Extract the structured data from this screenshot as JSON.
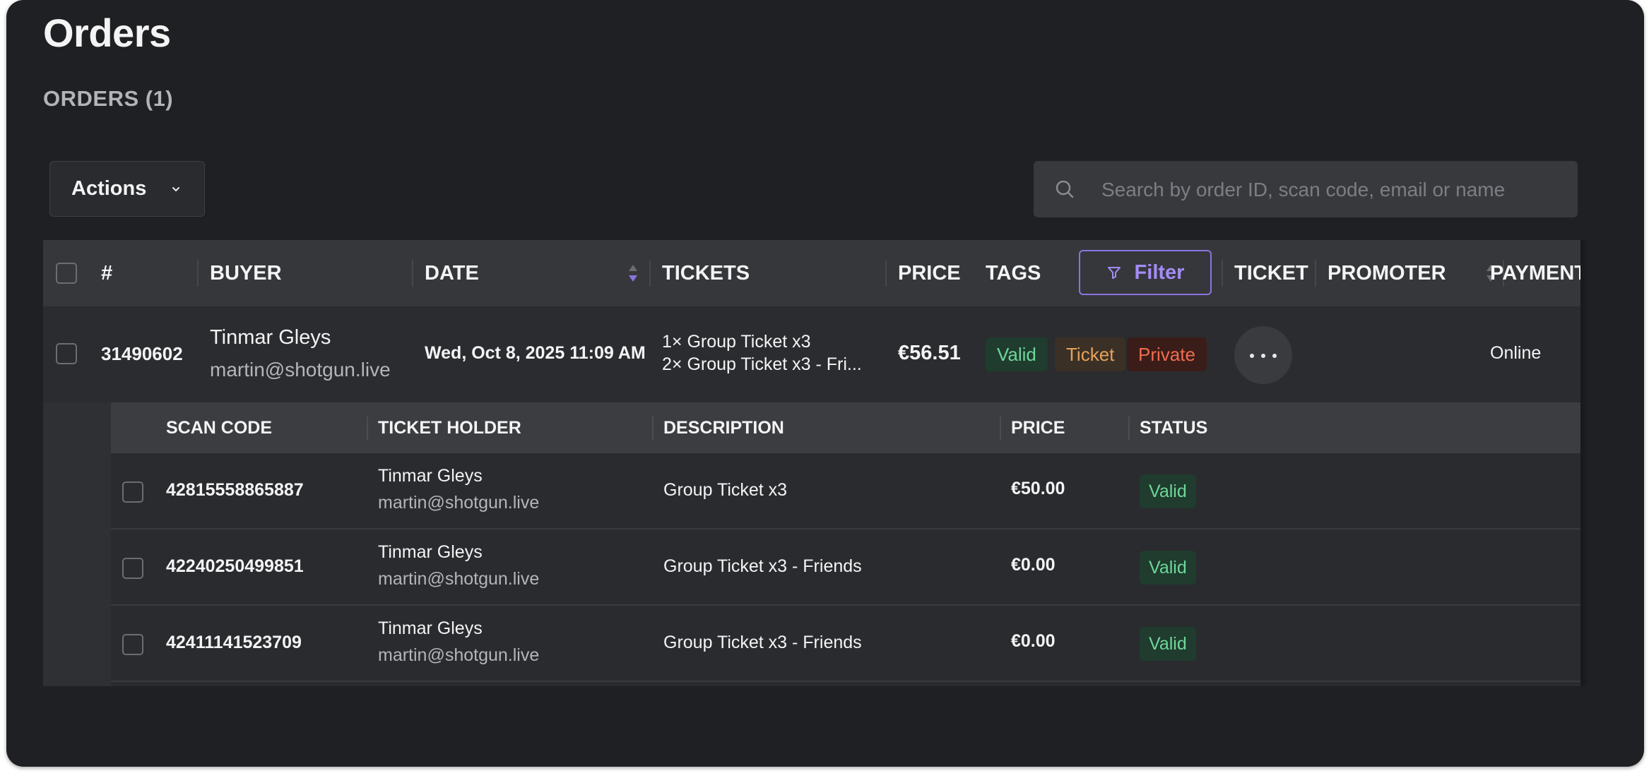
{
  "page": {
    "title": "Orders",
    "section_title": "ORDERS (1)"
  },
  "toolbar": {
    "actions_label": "Actions",
    "search_placeholder": "Search by order ID, scan code, email or name"
  },
  "table": {
    "headers": {
      "number": "#",
      "buyer": "BUYER",
      "date": "DATE",
      "tickets": "TICKETS",
      "price": "PRICE",
      "tags": "TAGS",
      "filter": "Filter",
      "ticket": "TICKET",
      "promoter": "PROMOTER",
      "payment": "PAYMENT"
    },
    "order": {
      "id": "31490602",
      "buyer_name": "Tinmar Gleys",
      "buyer_email": "martin@shotgun.live",
      "date": "Wed, Oct 8, 2025 11:09 AM",
      "tickets_line1": "1× Group Ticket x3",
      "tickets_line2": "2× Group Ticket x3 - Fri...",
      "price": "€56.51",
      "tags": [
        "Valid",
        "Ticket",
        "Private"
      ],
      "payment": "Online"
    },
    "sub_headers": {
      "scan_code": "SCAN CODE",
      "ticket_holder": "TICKET HOLDER",
      "description": "DESCRIPTION",
      "price": "PRICE",
      "status": "STATUS"
    },
    "tickets": [
      {
        "scan_code": "42815558865887",
        "holder_name": "Tinmar Gleys",
        "holder_email": "martin@shotgun.live",
        "description": "Group Ticket x3",
        "price": "€50.00",
        "status": "Valid"
      },
      {
        "scan_code": "42240250499851",
        "holder_name": "Tinmar Gleys",
        "holder_email": "martin@shotgun.live",
        "description": "Group Ticket x3 - Friends",
        "price": "€0.00",
        "status": "Valid"
      },
      {
        "scan_code": "42411141523709",
        "holder_name": "Tinmar Gleys",
        "holder_email": "martin@shotgun.live",
        "description": "Group Ticket x3 - Friends",
        "price": "€0.00",
        "status": "Valid"
      }
    ]
  },
  "colors": {
    "background": "#1f2023",
    "accent": "#a48cf5",
    "valid_text": "#6fd69a",
    "ticket_tag_text": "#e6a15a",
    "private_tag_text": "#f26b4f"
  }
}
